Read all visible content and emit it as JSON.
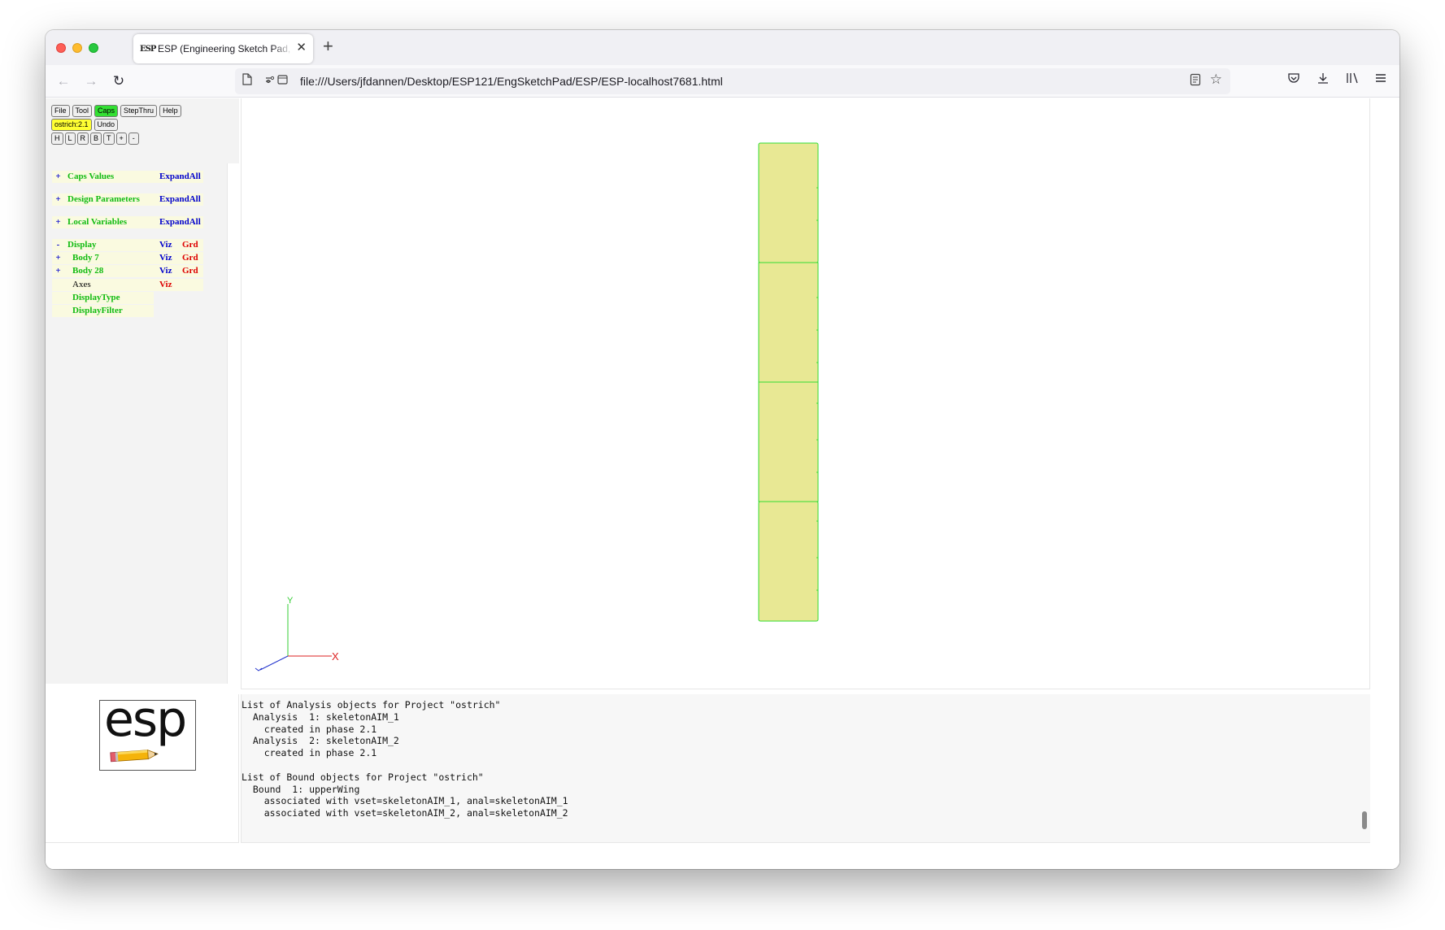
{
  "browser": {
    "tab_favicon": "ESP",
    "tab_title": "ESP (Engineering Sketch Pad, V",
    "url": "file:///Users/jfdannen/Desktop/ESP121/EngSketchPad/ESP/ESP-localhost7681.html",
    "icons": [
      "back-icon",
      "forward-icon",
      "reload-icon",
      "page-icon",
      "permissions-icon",
      "reader-view-icon",
      "bookmark-star-icon",
      "pocket-icon",
      "download-icon",
      "library-icon",
      "menu-icon"
    ]
  },
  "toolbar": {
    "row1": [
      "File",
      "Tool",
      "Caps",
      "StepThru",
      "Help"
    ],
    "active_button": "Caps",
    "phase_label": "ostrich:2.1",
    "undo_label": "Undo",
    "view_buttons": [
      "H",
      "L",
      "R",
      "B",
      "T",
      "+",
      "-"
    ]
  },
  "tree": {
    "caps_values": {
      "sign": "+",
      "label": "Caps Values",
      "action": "ExpandAll"
    },
    "design_parameters": {
      "sign": "+",
      "label": "Design Parameters",
      "action": "ExpandAll"
    },
    "local_variables": {
      "sign": "+",
      "label": "Local Variables",
      "action": "ExpandAll"
    },
    "display": {
      "sign": "-",
      "label": "Display",
      "viz": "Viz",
      "grd": "Grd"
    },
    "body7": {
      "sign": "+",
      "label": "Body 7",
      "viz": "Viz",
      "grd": "Grd"
    },
    "body28": {
      "sign": "+",
      "label": "Body 28",
      "viz": "Viz",
      "grd": "Grd"
    },
    "axes": {
      "label": "Axes",
      "viz": "Viz"
    },
    "display_type": {
      "label": "DisplayType"
    },
    "display_filter": {
      "label": "DisplayFilter"
    }
  },
  "graphics": {
    "axis_labels": {
      "x": "X",
      "y": "Y"
    },
    "colors": {
      "face_fill": "#e8e894",
      "edge": "#33dd33",
      "x_axis": "#dd2222",
      "y_axis": "#33cc33",
      "z_axis": "#2233cc"
    }
  },
  "logo": {
    "text": "esp"
  },
  "messages": {
    "lines": [
      "List of Analysis objects for Project \"ostrich\"",
      "  Analysis  1: skeletonAIM_1",
      "    created in phase 2.1",
      "  Analysis  2: skeletonAIM_2",
      "    created in phase 2.1",
      "",
      "List of Bound objects for Project \"ostrich\"",
      "  Bound  1: upperWing",
      "    associated with vset=skeletonAIM_1, anal=skeletonAIM_1",
      "    associated with vset=skeletonAIM_2, anal=skeletonAIM_2"
    ]
  }
}
